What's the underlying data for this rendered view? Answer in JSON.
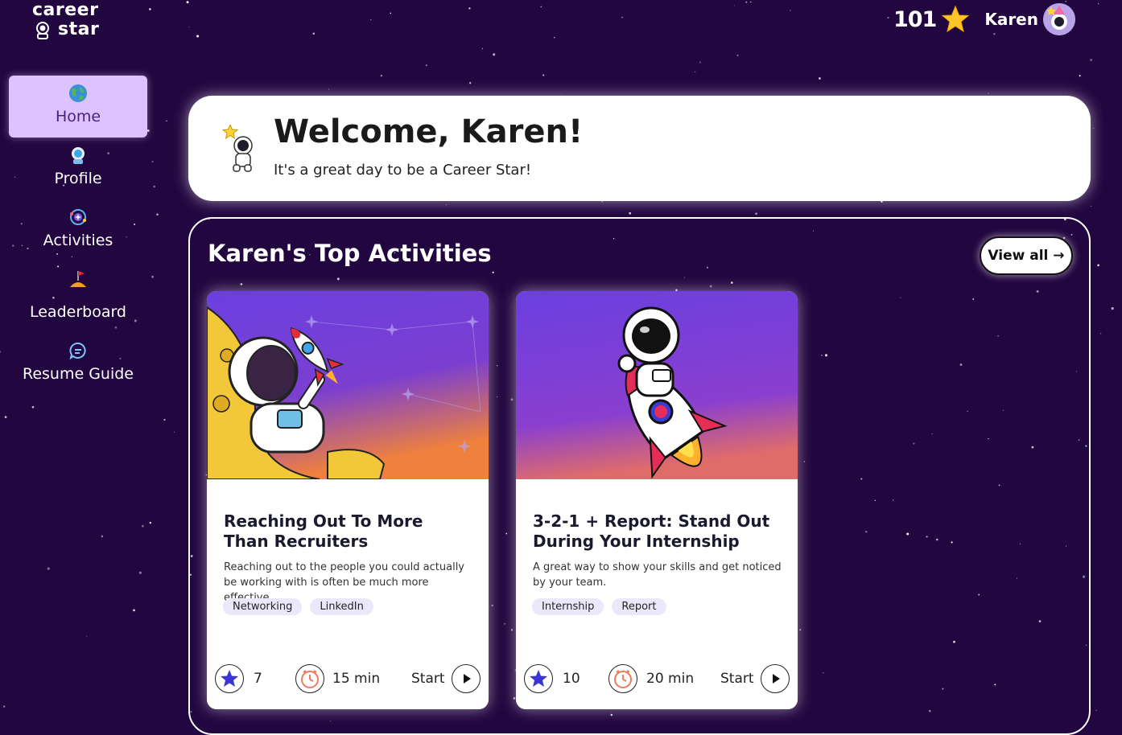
{
  "app": {
    "logo_line1": "career",
    "logo_line2": "star",
    "points": "101",
    "username": "Karen"
  },
  "sidebar": {
    "items": [
      {
        "label": "Home",
        "icon": "globe-icon",
        "active": true
      },
      {
        "label": "Profile",
        "icon": "astronaut-icon",
        "active": false
      },
      {
        "label": "Activities",
        "icon": "orbit-icon",
        "active": false
      },
      {
        "label": "Leaderboard",
        "icon": "flag-icon",
        "active": false
      },
      {
        "label": "Resume Guide",
        "icon": "chat-icon",
        "active": false
      }
    ]
  },
  "welcome": {
    "title": "Welcome, Karen!",
    "subtitle": "It's a great day to be a Career Star!"
  },
  "activities": {
    "title": "Karen's Top Activities",
    "view_all": "View all →",
    "cards": [
      {
        "title": "Reaching Out To More Than Recruiters",
        "description": "Reaching out to the people you could actually be working with is often be much more effective.",
        "tags": [
          "Networking",
          "LinkedIn"
        ],
        "stars": "7",
        "duration": "15 min",
        "start": "Start"
      },
      {
        "title": "3-2-1 + Report: Stand Out During Your Internship",
        "description": "A great way to show your skills and get noticed by your team.",
        "tags": [
          "Internship",
          "Report"
        ],
        "stars": "10",
        "duration": "20 min",
        "start": "Start"
      }
    ]
  },
  "colors": {
    "background": "#22063f",
    "active_nav": "#dcc3ff",
    "star_badge": "#3b35d6",
    "clock": "#f07a5a",
    "tag_bg": "#ece8fb"
  }
}
